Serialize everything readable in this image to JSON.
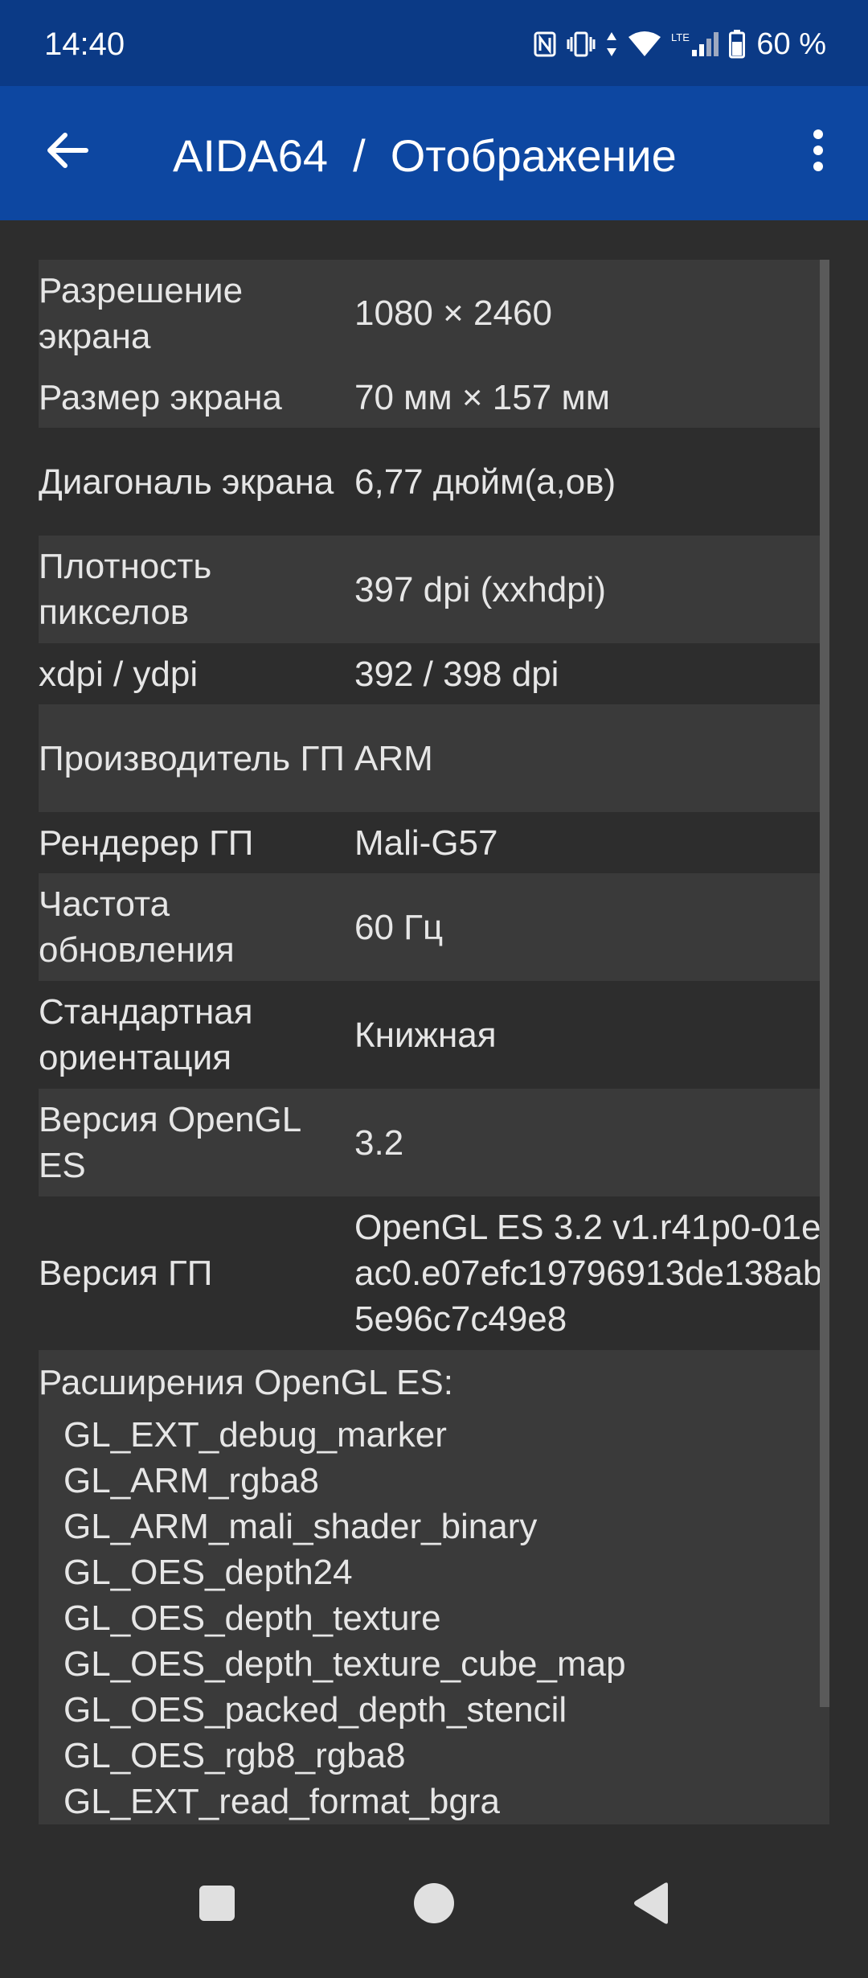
{
  "status_bar": {
    "time": "14:40",
    "network_label": "LTE",
    "battery": "60 %",
    "icons": [
      "nfc-icon",
      "vibrate-icon",
      "data-arrows-icon",
      "wifi-icon",
      "signal-icon",
      "battery-icon"
    ]
  },
  "app_bar": {
    "title": "AIDA64  /  Отображение",
    "back_icon": "arrow-left-icon",
    "menu_icon": "more-vert-icon",
    "color": "#0d47a1"
  },
  "rows": [
    {
      "label": "Разрешение экрана",
      "value": "1080 × 2460"
    },
    {
      "label": "Размер экрана",
      "value": "70 мм × 157 мм"
    },
    {
      "label": "Диагональ экрана",
      "value": "6,77 дюйм(а,ов)"
    },
    {
      "label": "Плотность пикселов",
      "value": "397 dpi (xxhdpi)"
    },
    {
      "label": "xdpi / ydpi",
      "value": "392 / 398 dpi"
    },
    {
      "label": "Производитель ГП",
      "value": "ARM"
    },
    {
      "label": "Рендерер ГП",
      "value": "Mali-G57"
    },
    {
      "label": "Частота обновления",
      "value": "60 Гц"
    },
    {
      "label": "Стандартная ориентация",
      "value": "Книжная"
    },
    {
      "label": "Версия OpenGL ES",
      "value": "3.2"
    },
    {
      "label": "Версия ГП",
      "value": "OpenGL ES 3.2 v1.r41p0-01eac0.e07efc19796913de138ab5e96c7c49e8"
    }
  ],
  "extensions": {
    "title": "Расширения OpenGL ES:",
    "items": [
      "GL_EXT_debug_marker",
      "GL_ARM_rgba8",
      "GL_ARM_mali_shader_binary",
      "GL_OES_depth24",
      "GL_OES_depth_texture",
      "GL_OES_depth_texture_cube_map",
      "GL_OES_packed_depth_stencil",
      "GL_OES_rgb8_rgba8",
      "GL_EXT_read_format_bgra"
    ]
  },
  "nav_bar": {
    "icons": [
      "recents-square-icon",
      "home-circle-icon",
      "back-triangle-icon"
    ]
  }
}
